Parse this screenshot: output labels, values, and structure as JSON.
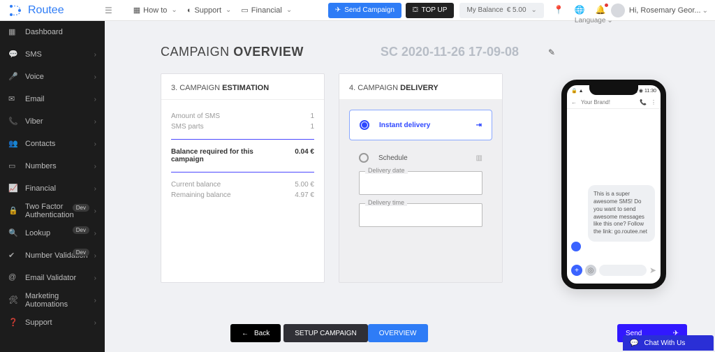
{
  "brand": {
    "name": "Routee"
  },
  "topnav": {
    "items": [
      "How to",
      "Support",
      "Financial"
    ],
    "send_campaign": "Send Campaign",
    "top_up": "TOP UP",
    "balance_label": "My Balance",
    "balance_value": "€ 5.00",
    "language": "Language",
    "greeting": "Hi, Rosemary Geor..."
  },
  "sidebar": {
    "items": [
      {
        "label": "Dashboard",
        "expandable": false
      },
      {
        "label": "SMS",
        "expandable": true
      },
      {
        "label": "Voice",
        "expandable": true
      },
      {
        "label": "Email",
        "expandable": true
      },
      {
        "label": "Viber",
        "expandable": true
      },
      {
        "label": "Contacts",
        "expandable": true
      },
      {
        "label": "Numbers",
        "expandable": true
      },
      {
        "label": "Financial",
        "expandable": true
      },
      {
        "label": "Two Factor Authentication",
        "expandable": true,
        "badge": "Dev"
      },
      {
        "label": "Lookup",
        "expandable": true,
        "badge": "Dev"
      },
      {
        "label": "Number Validation",
        "expandable": true,
        "badge": "Dev"
      },
      {
        "label": "Email Validator",
        "expandable": true
      },
      {
        "label": "Marketing Automations",
        "expandable": true
      },
      {
        "label": "Support",
        "expandable": true
      }
    ]
  },
  "page_title": {
    "pre": "CAMPAIGN ",
    "strong": "OVERVIEW"
  },
  "campaign_name": "SC 2020-11-26 17-09-08",
  "estimation": {
    "heading_num": "3. CAMPAIGN ",
    "heading_strong": "ESTIMATION",
    "rows": {
      "amount_label": "Amount of SMS",
      "amount_value": "1",
      "parts_label": "SMS parts",
      "parts_value": "1",
      "required_label": "Balance required for this campaign",
      "required_value": "0.04 €",
      "current_label": "Current balance",
      "current_value": "5.00 €",
      "remaining_label": "Remaining balance",
      "remaining_value": "4.97 €"
    }
  },
  "delivery": {
    "heading_num": "4. CAMPAIGN ",
    "heading_strong": "DELIVERY",
    "instant_label": "Instant delivery",
    "schedule_label": "Schedule",
    "date_label": "Delivery date",
    "time_label": "Delivery time"
  },
  "phone": {
    "time": "11:30",
    "brand": "Your Brand!",
    "message": "This is a super awesome SMS! Do you want to send awesome messages like this one? Follow the link: go.routee.net"
  },
  "footer": {
    "back": "Back",
    "setup": "SETUP CAMPAIGN",
    "overview": "OVERVIEW",
    "send": "Send"
  },
  "chat_widget": "Chat With Us"
}
